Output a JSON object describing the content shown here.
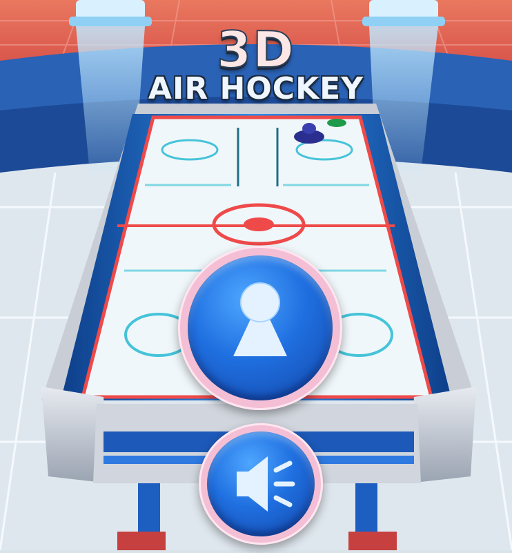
{
  "title": {
    "big": "3D",
    "sub": "AIR HOCKEY"
  },
  "buttons": {
    "play": {
      "icon": "single-player-icon"
    },
    "sound": {
      "icon": "speaker-icon"
    }
  },
  "colors": {
    "button_blue": "#1f6fe0",
    "button_ring": "#f2b6cf",
    "table_rail_blue": "#1b6fd0",
    "table_line_red": "#ef4a4a",
    "floor_red": "#e55b4c"
  }
}
